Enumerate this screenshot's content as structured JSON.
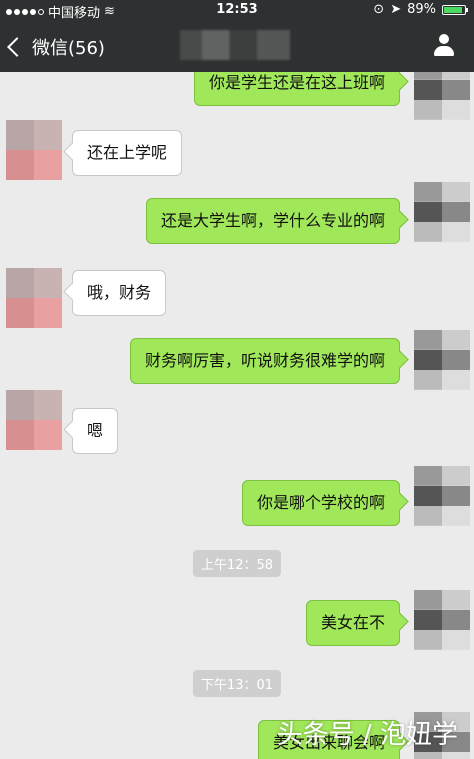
{
  "status_bar": {
    "carrier": "中国移动",
    "time": "12:53",
    "battery": "89%",
    "battery_level": 0.89
  },
  "nav": {
    "back_label": "微信(56)"
  },
  "messages": [
    {
      "side": "right",
      "text": "你是学生还是在这上班啊"
    },
    {
      "side": "left",
      "text": "还在上学呢"
    },
    {
      "side": "right",
      "text": "还是大学生啊，学什么专业的啊"
    },
    {
      "side": "left",
      "text": "哦，财务"
    },
    {
      "side": "right",
      "text": "财务啊厉害，听说财务很难学的啊"
    },
    {
      "side": "left",
      "text": "嗯"
    },
    {
      "side": "right",
      "text": "你是哪个学校的啊"
    },
    {
      "side": "right",
      "text": "美女在不"
    },
    {
      "side": "right",
      "text": "美女出来聊会啊"
    }
  ],
  "timestamps": [
    "上午12：58",
    "下午13：01"
  ],
  "watermark": "头条号 / 泡妞学",
  "colors": {
    "bar": "#2e3132",
    "chat_bg": "#ebebeb",
    "green_bubble": "#a0e75a",
    "white_bubble": "#ffffff"
  }
}
